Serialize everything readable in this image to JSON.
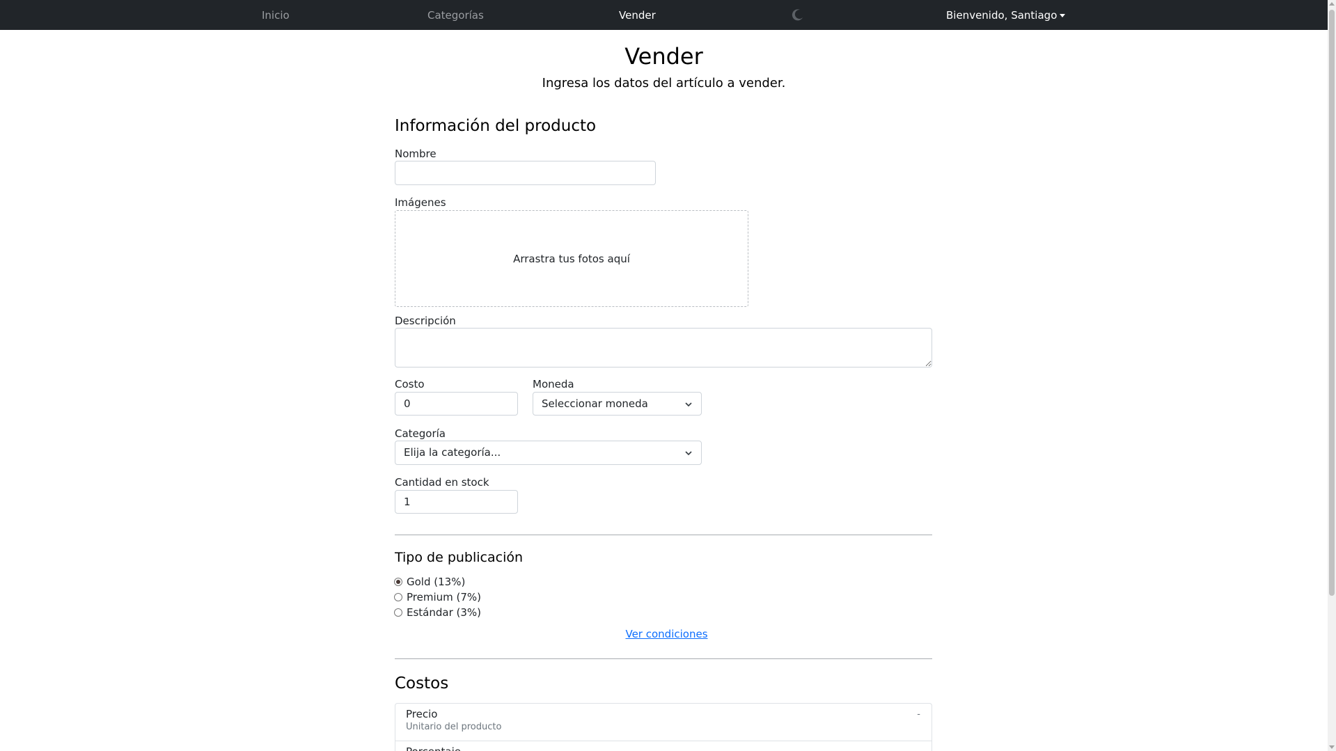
{
  "nav": {
    "inicio": "Inicio",
    "categorias": "Categorías",
    "vender": "Vender",
    "user": "Bienvenido, Santiago",
    "theme_icon": "moon-icon"
  },
  "page": {
    "title": "Vender",
    "subtitle": "Ingresa los datos del artículo a vender."
  },
  "product_section": {
    "title": "Información del producto",
    "name_label": "Nombre",
    "name_value": "",
    "images_label": "Imágenes",
    "dropzone_text": "Arrastra tus fotos aquí",
    "description_label": "Descripción",
    "description_value": "",
    "cost_label": "Costo",
    "cost_value": "0",
    "currency_label": "Moneda",
    "currency_selected": "Seleccionar moneda",
    "category_label": "Categoría",
    "category_selected": "Elija la categoría...",
    "stock_label": "Cantidad en stock",
    "stock_value": "1"
  },
  "publication_section": {
    "title": "Tipo de publicación",
    "options": [
      {
        "label": "Gold (13%)",
        "checked": true
      },
      {
        "label": "Premium (7%)",
        "checked": false
      },
      {
        "label": "Estándar (3%)",
        "checked": false
      }
    ],
    "conditions_link": "Ver condiciones"
  },
  "costs_section": {
    "title": "Costos",
    "items": [
      {
        "title": "Precio",
        "subtitle": "Unitario del producto",
        "value": "-"
      },
      {
        "title": "Porcentaje",
        "subtitle": "",
        "value": ""
      }
    ]
  },
  "colors": {
    "navbar_bg": "#212529",
    "link": "#0d6efd",
    "radio_checked": "#4a3a36"
  }
}
